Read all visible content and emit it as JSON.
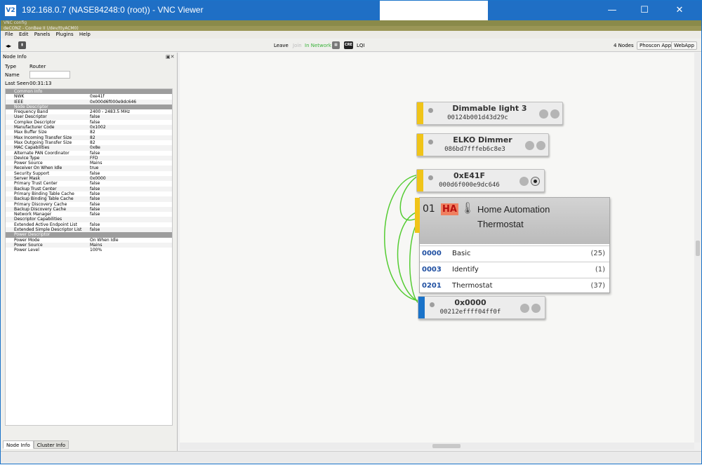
{
  "window": {
    "title": "192.168.0.7 (NASE84248:0 (root)) - VNC Viewer",
    "app_icon": "V2",
    "controls": [
      "—",
      "☐",
      "✕"
    ]
  },
  "vnc": {
    "config_label": "VNC config",
    "inner_title": "deCONZ - ConBee II (/dev/ttyACM0)"
  },
  "menu": [
    "File",
    "Edit",
    "Panels",
    "Plugins",
    "Help"
  ],
  "toolbar": {
    "leave": "Leave",
    "join": "Join",
    "in_network": "In Network",
    "cre": "CRE",
    "lqi": "LQI",
    "nodes_count": "4 Nodes",
    "phoscon_btn": "Phoscon App",
    "webapp_btn": "WebApp"
  },
  "node_info": {
    "panel_title": "Node Info",
    "type_label": "Type",
    "type_value": "Router",
    "name_label": "Name",
    "name_value": "",
    "last_seen_label": "Last Seen",
    "last_seen_value": "00:31:13",
    "sections": [
      {
        "title": "Common Info",
        "rows": [
          [
            "NWK",
            "0xe41f"
          ],
          [
            "IEEE",
            "0x000d6f000e9dc646"
          ]
        ]
      },
      {
        "title": "Node Descriptor",
        "rows": [
          [
            "Frequency Band",
            "2400 - 2483.5 MHz"
          ],
          [
            "User Descriptor",
            "false"
          ],
          [
            "Complex Descriptor",
            "false"
          ],
          [
            "Manufacturer Code",
            "0x1002"
          ],
          [
            "Max Buffer Size",
            "82"
          ],
          [
            "Max Incoming Transfer Size",
            "82"
          ],
          [
            "Max Outgoing Transfer Size",
            "82"
          ],
          [
            "MAC Capabilities",
            "0x8e"
          ],
          [
            "Alternate PAN Coordinator",
            "false"
          ],
          [
            "Device Type",
            "FFD"
          ],
          [
            "Power Source",
            "Mains"
          ],
          [
            "Receiver On When Idle",
            "true"
          ],
          [
            "Security Support",
            "false"
          ],
          [
            "Server Mask",
            "0x0000"
          ],
          [
            "Primary Trust Center",
            "false"
          ],
          [
            "Backup Trust Center",
            "false"
          ],
          [
            "Primary Binding Table Cache",
            "false"
          ],
          [
            "Backup Binding Table Cache",
            "false"
          ],
          [
            "Primary Discovery Cache",
            "false"
          ],
          [
            "Backup Discovery Cache",
            "false"
          ],
          [
            "Network Manager",
            "false"
          ],
          [
            "Descriptor Capabilities",
            ""
          ],
          [
            "Extended Active Endpoint List",
            "false"
          ],
          [
            "Extended Simple Descriptor List",
            "false"
          ]
        ]
      },
      {
        "title": "Power Descriptor",
        "rows": [
          [
            "Power Mode",
            "On When Idle"
          ],
          [
            "Power Source",
            "Mains"
          ],
          [
            "Power Level",
            "100%"
          ]
        ]
      }
    ],
    "tabs": [
      "Node Info",
      "Cluster Info"
    ]
  },
  "graph": {
    "nodes": [
      {
        "name": "Dimmable light 3",
        "mac": "00124b001d43d29c",
        "color": "#f0c419"
      },
      {
        "name": "ELKO Dimmer",
        "mac": "086bd7fffeb6c8e3",
        "color": "#f0c419"
      },
      {
        "name": "0xE41F",
        "mac": "000d6f000e9dc646",
        "color": "#f0c419"
      },
      {
        "name": "0x0000",
        "mac": "00212effff04ff0f",
        "color": "#1a73c9"
      }
    ],
    "endpoint": {
      "number": "01",
      "profile_badge": "HA",
      "device_line1": "Home Automation",
      "device_line2": "Thermostat",
      "clusters": [
        {
          "id": "0000",
          "name": "Basic",
          "count": "(25)"
        },
        {
          "id": "0003",
          "name": "Identify",
          "count": "(1)"
        },
        {
          "id": "0201",
          "name": "Thermostat",
          "count": "(37)"
        }
      ]
    },
    "link_color": "#55cc33"
  }
}
